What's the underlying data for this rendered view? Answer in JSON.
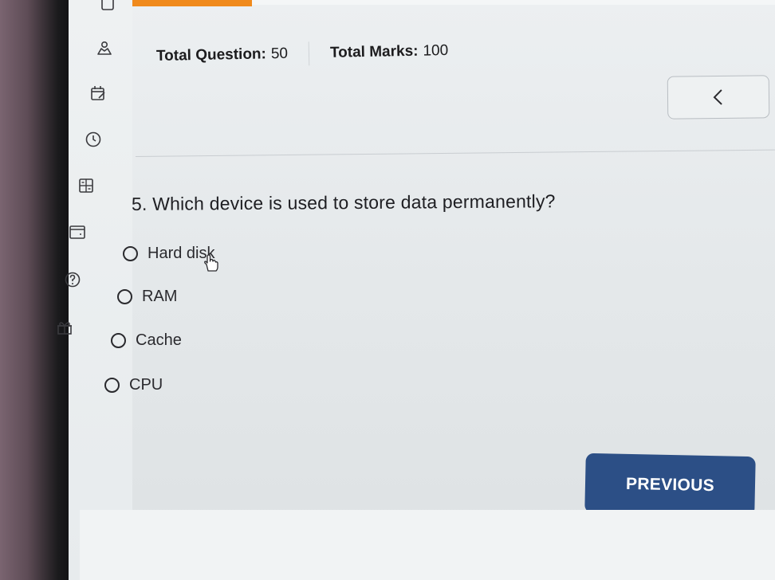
{
  "header": {
    "total_question_label": "Total Question:",
    "total_question_value": "50",
    "total_marks_label": "Total Marks:",
    "total_marks_value": "100"
  },
  "nav": {
    "prev_arrow_icon": "chevron-left-icon"
  },
  "sidebar": {
    "icons": [
      "person-icon",
      "calendar-edit-icon",
      "clock-icon",
      "calculator-icon",
      "card-icon",
      "help-icon",
      "gift-icon"
    ]
  },
  "question": {
    "text": "5. Which device is used to store data permanently?",
    "options": [
      {
        "label": "Hard disk",
        "selected": false
      },
      {
        "label": "RAM",
        "selected": false
      },
      {
        "label": "Cache",
        "selected": false
      },
      {
        "label": "CPU",
        "selected": false
      }
    ]
  },
  "buttons": {
    "previous": "PREVIOUS"
  },
  "colors": {
    "accent_orange": "#f08a1c",
    "button_blue": "#2c4f86"
  }
}
